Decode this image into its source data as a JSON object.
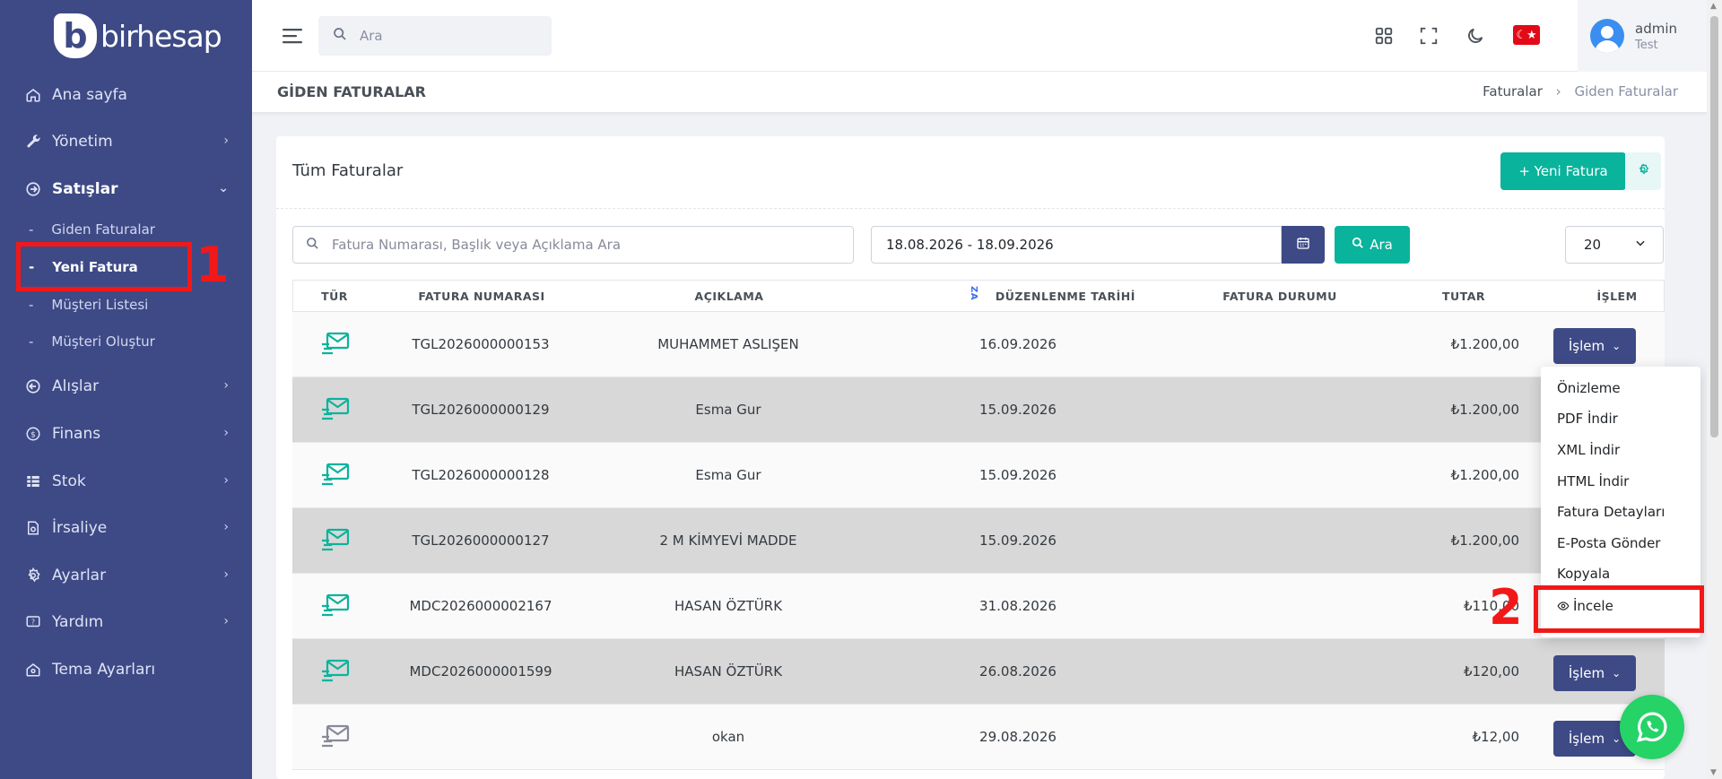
{
  "app": {
    "logo_letter": "b",
    "logo_text": "birhesap"
  },
  "sidebar": {
    "items": [
      {
        "label": "Ana sayfa",
        "icon": "home-icon"
      },
      {
        "label": "Yönetim",
        "icon": "wrench-icon"
      },
      {
        "label": "Satışlar",
        "icon": "sales-icon"
      },
      {
        "label": "Alışlar",
        "icon": "purchases-icon"
      },
      {
        "label": "Finans",
        "icon": "finance-icon"
      },
      {
        "label": "Stok",
        "icon": "stock-icon"
      },
      {
        "label": "İrsaliye",
        "icon": "waybill-icon"
      },
      {
        "label": "Ayarlar",
        "icon": "settings-icon"
      },
      {
        "label": "Yardım",
        "icon": "help-icon"
      },
      {
        "label": "Tema Ayarları",
        "icon": "theme-icon"
      }
    ],
    "sub_items": [
      {
        "label": "Giden Faturalar"
      },
      {
        "label": "Yeni Fatura"
      },
      {
        "label": "Müşteri Listesi"
      },
      {
        "label": "Müşteri Oluştur"
      }
    ]
  },
  "topbar": {
    "search_placeholder": "Ara",
    "user_name": "admin",
    "user_role": "Test",
    "flag_symbol": "☾★"
  },
  "page": {
    "title": "GİDEN FATURALAR",
    "breadcrumb": [
      "Faturalar",
      "Giden Faturalar"
    ],
    "breadcrumb_sep": "›"
  },
  "card": {
    "title": "Tüm Faturalar",
    "new_button": "+ Yeni Fatura",
    "filter_placeholder": "Fatura Numarası, Başlık veya Açıklama Ara",
    "date_range": "18.08.2026 - 18.09.2026",
    "search_button": "Ara",
    "page_size": "20"
  },
  "table": {
    "columns": [
      "TÜR",
      "FATURA NUMARASI",
      "AÇIKLAMA",
      "DÜZENLENME TARİHİ",
      "FATURA DURUMU",
      "TUTAR",
      "İŞLEM"
    ],
    "sort_icon_text": "ZA",
    "action_label": "İşlem",
    "rows": [
      {
        "number": "TGL2026000000153",
        "desc": "MUHAMMET ASLIŞEN",
        "date": "16.09.2026",
        "status": "",
        "amount": "₺1.200,00",
        "icon_color": "#0ab39c"
      },
      {
        "number": "TGL2026000000129",
        "desc": "Esma Gur",
        "date": "15.09.2026",
        "status": "",
        "amount": "₺1.200,00",
        "icon_color": "#0ab39c"
      },
      {
        "number": "TGL2026000000128",
        "desc": "Esma Gur",
        "date": "15.09.2026",
        "status": "",
        "amount": "₺1.200,00",
        "icon_color": "#0ab39c"
      },
      {
        "number": "TGL2026000000127",
        "desc": "2 M KİMYEVİ MADDE",
        "date": "15.09.2026",
        "status": "",
        "amount": "₺1.200,00",
        "icon_color": "#0ab39c"
      },
      {
        "number": "MDC2026000002167",
        "desc": "HASAN ÖZTÜRK",
        "date": "31.08.2026",
        "status": "",
        "amount": "₺110,00",
        "icon_color": "#0ab39c"
      },
      {
        "number": "MDC2026000001599",
        "desc": "HASAN ÖZTÜRK",
        "date": "26.08.2026",
        "status": "",
        "amount": "₺120,00",
        "icon_color": "#0ab39c"
      },
      {
        "number": "",
        "desc": "okan",
        "date": "29.08.2026",
        "status": "",
        "amount": "₺12,00",
        "icon_color": "#878a99"
      }
    ]
  },
  "dropdown": {
    "items": [
      "Önizleme",
      "PDF İndir",
      "XML İndir",
      "HTML İndir",
      "Fatura Detayları",
      "E-Posta Gönder",
      "Kopyala",
      "İncele"
    ]
  },
  "annotations": {
    "label_1": "1",
    "label_2": "2",
    "color": "#f21818"
  },
  "colors": {
    "sidebar": "#3e4a86",
    "accent": "#0ab39c",
    "primary": "#3e4a86"
  }
}
